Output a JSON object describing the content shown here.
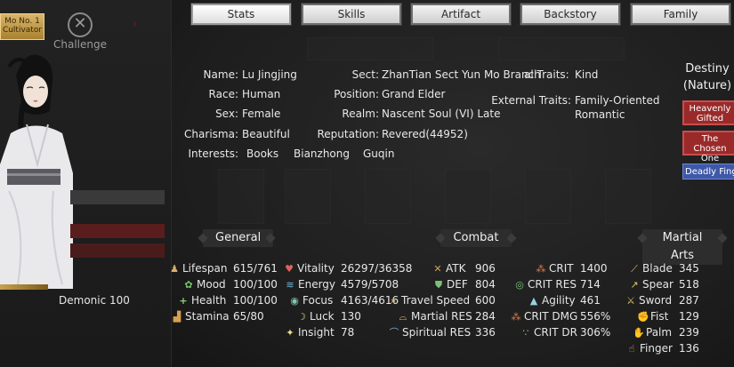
{
  "left": {
    "badge_line1": "Mo No. 1",
    "badge_line2": "Cultivator",
    "challenge_label": "Challenge",
    "demonic_text": "Demonic 100"
  },
  "tabs": [
    {
      "label": "Stats",
      "active": true
    },
    {
      "label": "Skills"
    },
    {
      "label": "Artifact"
    },
    {
      "label": "Backstory"
    },
    {
      "label": "Family"
    }
  ],
  "profile": {
    "name_label": "Name:",
    "name": "Lu Jingjing",
    "race_label": "Race:",
    "race": "Human",
    "sex_label": "Sex:",
    "sex": "Female",
    "charisma_label": "Charisma:",
    "charisma": "Beautiful",
    "interests_label": "Interests:",
    "interests": [
      "Books",
      "Bianzhong",
      "Guqin"
    ],
    "sect_label": "Sect:",
    "sect": "ZhanTian Sect Yun Mo Branch",
    "position_label": "Position:",
    "position": "Grand Elder",
    "realm_label": "Realm:",
    "realm": "Nascent Soul (VI) Late",
    "reputation_label": "Reputation:",
    "reputation": "Revered(44952)",
    "internal_traits_label": "al Traits:",
    "internal_traits": "Kind",
    "external_traits_label": "External Traits:",
    "external_traits_1": "Family-Oriented",
    "external_traits_2": "Romantic"
  },
  "destiny": {
    "title_1": "Destiny",
    "title_2": "(Nature)",
    "traits": [
      {
        "line1": "Heavenly",
        "line2": "Gifted",
        "color": "red"
      },
      {
        "line1": "The Chosen",
        "line2": "One",
        "color": "red"
      },
      {
        "line1": "Deadly Finge",
        "line2": "",
        "color": "blue"
      }
    ]
  },
  "sections": {
    "general": "General",
    "combat": "Combat",
    "martial_arts": "Martial Arts"
  },
  "general": [
    {
      "icon": "lifespan-icon",
      "glyph": "♟",
      "label": "Lifespan",
      "value": "615/761"
    },
    {
      "icon": "mood-icon",
      "glyph": "✿",
      "label": "Mood",
      "value": "100/100"
    },
    {
      "icon": "health-icon",
      "glyph": "+",
      "label": "Health",
      "value": "100/100"
    },
    {
      "icon": "stamina-icon",
      "glyph": "▟",
      "label": "Stamina",
      "value": "65/80"
    }
  ],
  "general2": [
    {
      "icon": "vitality-icon",
      "glyph": "♥",
      "label": "Vitality",
      "value": "26297/36358"
    },
    {
      "icon": "energy-icon",
      "glyph": "≋",
      "label": "Energy",
      "value": "4579/5708"
    },
    {
      "icon": "focus-icon",
      "glyph": "◉",
      "label": "Focus",
      "value": "4163/4616"
    },
    {
      "icon": "luck-icon",
      "glyph": "☽",
      "label": "Luck",
      "value": "130"
    },
    {
      "icon": "insight-icon",
      "glyph": "✦",
      "label": "Insight",
      "value": "78"
    }
  ],
  "combat": [
    {
      "icon": "atk-icon",
      "glyph": "✕",
      "label": "ATK",
      "value": "906"
    },
    {
      "icon": "def-icon",
      "glyph": "⛊",
      "label": "DEF",
      "value": "804"
    },
    {
      "icon": "travel-speed-icon",
      "glyph": "»",
      "label": "Travel Speed",
      "value": "600"
    },
    {
      "icon": "martial-res-icon",
      "glyph": "⌓",
      "label": "Martial RES",
      "value": "284"
    },
    {
      "icon": "spiritual-res-icon",
      "glyph": "⌒",
      "label": "Spiritual RES",
      "value": "336"
    }
  ],
  "combat2": [
    {
      "icon": "crit-icon",
      "glyph": "⁂",
      "label": "CRIT",
      "value": "1400"
    },
    {
      "icon": "crit-res-icon",
      "glyph": "◎",
      "label": "CRIT RES",
      "value": "714"
    },
    {
      "icon": "agility-icon",
      "glyph": "▲",
      "label": "Agility",
      "value": "461"
    },
    {
      "icon": "crit-dmg-icon",
      "glyph": "⁂",
      "label": "CRIT DMG",
      "value": "556%"
    },
    {
      "icon": "crit-dr-icon",
      "glyph": "∵",
      "label": "CRIT DR",
      "value": "306%"
    }
  ],
  "martial": [
    {
      "icon": "blade-icon",
      "glyph": "⟋",
      "label": "Blade",
      "value": "345"
    },
    {
      "icon": "spear-icon",
      "glyph": "↗",
      "label": "Spear",
      "value": "518"
    },
    {
      "icon": "sword-icon",
      "glyph": "⚔",
      "label": "Sword",
      "value": "287"
    },
    {
      "icon": "fist-icon",
      "glyph": "✊",
      "label": "Fist",
      "value": "129"
    },
    {
      "icon": "palm-icon",
      "glyph": "✋",
      "label": "Palm",
      "value": "239"
    },
    {
      "icon": "finger-icon",
      "glyph": "☝",
      "label": "Finger",
      "value": "136"
    }
  ]
}
